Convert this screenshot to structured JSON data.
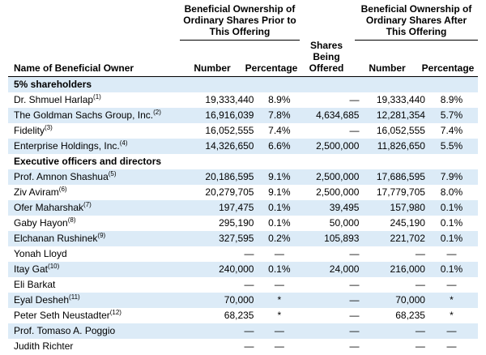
{
  "header": {
    "prior_group": [
      "Beneficial Ownership of",
      "Ordinary Shares Prior to",
      "This Offering"
    ],
    "after_group": [
      "Beneficial Ownership of",
      "Ordinary Shares After",
      "This Offering"
    ],
    "col_name": "Name of Beneficial Owner",
    "col_number": "Number",
    "col_percentage": "Percentage",
    "col_offered": [
      "Shares",
      "Being",
      "Offered"
    ],
    "col_number_after": "Number",
    "col_percentage_after": "Percentage"
  },
  "rows": [
    {
      "type": "section",
      "name": "5% shareholders"
    },
    {
      "name": "Dr. Shmuel Harlap",
      "fn": "(1)",
      "number": "19,333,440",
      "pct": "8.9%",
      "offered": "—",
      "number_after": "19,333,440",
      "pct_after": "8.9%"
    },
    {
      "name": "The Goldman Sachs Group, Inc.",
      "fn": "(2)",
      "number": "16,916,039",
      "pct": "7.8%",
      "offered": "4,634,685",
      "number_after": "12,281,354",
      "pct_after": "5.7%"
    },
    {
      "name": "Fidelity",
      "fn": "(3)",
      "number": "16,052,555",
      "pct": "7.4%",
      "offered": "—",
      "number_after": "16,052,555",
      "pct_after": "7.4%"
    },
    {
      "name": "Enterprise Holdings, Inc.",
      "fn": "(4)",
      "number": "14,326,650",
      "pct": "6.6%",
      "offered": "2,500,000",
      "number_after": "11,826,650",
      "pct_after": "5.5%"
    },
    {
      "type": "section",
      "name": "Executive officers and directors"
    },
    {
      "name": "Prof. Amnon Shashua",
      "fn": "(5)",
      "number": "20,186,595",
      "pct": "9.1%",
      "offered": "2,500,000",
      "number_after": "17,686,595",
      "pct_after": "7.9%"
    },
    {
      "name": "Ziv Aviram",
      "fn": "(6)",
      "number": "20,279,705",
      "pct": "9.1%",
      "offered": "2,500,000",
      "number_after": "17,779,705",
      "pct_after": "8.0%"
    },
    {
      "name": "Ofer Maharshak",
      "fn": "(7)",
      "number": "197,475",
      "pct": "0.1%",
      "offered": "39,495",
      "number_after": "157,980",
      "pct_after": "0.1%"
    },
    {
      "name": "Gaby Hayon",
      "fn": "(8)",
      "number": "295,190",
      "pct": "0.1%",
      "offered": "50,000",
      "number_after": "245,190",
      "pct_after": "0.1%"
    },
    {
      "name": "Elchanan Rushinek",
      "fn": "(9)",
      "number": "327,595",
      "pct": "0.2%",
      "offered": "105,893",
      "number_after": "221,702",
      "pct_after": "0.1%"
    },
    {
      "name": "Yonah Lloyd",
      "fn": "",
      "number": "—",
      "pct": "—",
      "offered": "—",
      "number_after": "—",
      "pct_after": "—"
    },
    {
      "name": "Itay Gat",
      "fn": "(10)",
      "number": "240,000",
      "pct": "0.1%",
      "offered": "24,000",
      "number_after": "216,000",
      "pct_after": "0.1%"
    },
    {
      "name": "Eli Barkat",
      "fn": "",
      "number": "—",
      "pct": "—",
      "offered": "—",
      "number_after": "—",
      "pct_after": "—"
    },
    {
      "name": "Eyal Desheh",
      "fn": "(11)",
      "number": "70,000",
      "pct": "*",
      "offered": "—",
      "number_after": "70,000",
      "pct_after": "*"
    },
    {
      "name": "Peter Seth Neustadter",
      "fn": "(12)",
      "number": "68,235",
      "pct": "*",
      "offered": "—",
      "number_after": "68,235",
      "pct_after": "*"
    },
    {
      "name": "Prof. Tomaso A. Poggio",
      "fn": "",
      "number": "—",
      "pct": "—",
      "offered": "—",
      "number_after": "—",
      "pct_after": "—"
    },
    {
      "name": "Judith Richter",
      "fn": "",
      "number": "—",
      "pct": "—",
      "offered": "—",
      "number_after": "—",
      "pct_after": "—"
    }
  ]
}
